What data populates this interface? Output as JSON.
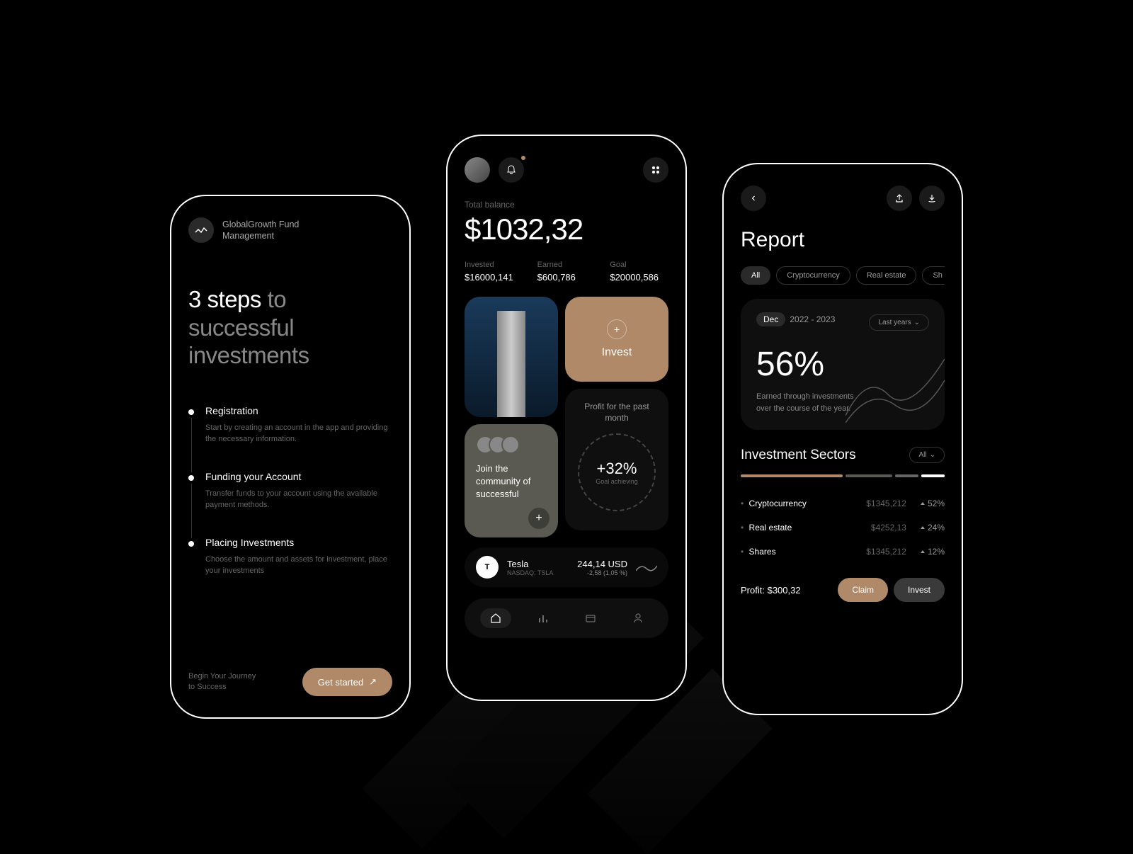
{
  "colors": {
    "accent": "#b08968",
    "bg": "#000000"
  },
  "screen1": {
    "brand_line1": "GlobalGrowth Fund",
    "brand_line2": "Management",
    "title_bold": "3 steps",
    "title_dim": " to successful investments",
    "steps": [
      {
        "title": "Registration",
        "desc": "Start by creating an account in the app and providing the necessary information."
      },
      {
        "title": "Funding your Account",
        "desc": "Transfer funds to your account using the available payment methods."
      },
      {
        "title": "Placing Investments",
        "desc": "Choose the amount and assets for investment, place your investments"
      }
    ],
    "footer_text_line1": "Begin Your Journey",
    "footer_text_line2": "to Success",
    "cta": "Get started"
  },
  "screen2": {
    "balance_label": "Total balance",
    "balance_value": "$1032,32",
    "stats": [
      {
        "label": "Invested",
        "value": "$16000,141"
      },
      {
        "label": "Earned",
        "value": "$600,786"
      },
      {
        "label": "Goal",
        "value": "$20000,586"
      }
    ],
    "invest_label": "Invest",
    "profit_label": "Profit for the past month",
    "profit_value": "+32%",
    "profit_sub": "Goal achieving",
    "community_text": "Join the community of successful",
    "ticker": {
      "symbol": "T",
      "name": "Tesla",
      "sub": "NASDAQ: TSLA",
      "price": "244,14 USD",
      "change": "-2,58 (1,05 %)"
    }
  },
  "screen3": {
    "title": "Report",
    "chips": [
      "All",
      "Cryptocurrency",
      "Real estate",
      "Sh"
    ],
    "date_month": "Dec",
    "date_range": "2022 - 2023",
    "dropdown": "Last years",
    "big_pct": "56%",
    "report_desc": "Earned through investments over the course of the year.",
    "sectors_title": "Investment Sectors",
    "sectors_filter": "All",
    "sectors": [
      {
        "name": "Cryptocurrency",
        "amount": "$1345,212",
        "pct": "52%"
      },
      {
        "name": "Real estate",
        "amount": "$4252,13",
        "pct": "24%"
      },
      {
        "name": "Shares",
        "amount": "$1345,212",
        "pct": "12%"
      }
    ],
    "profit_label": "Profit:",
    "profit_value": "$300,32",
    "claim": "Claim",
    "invest": "Invest"
  }
}
